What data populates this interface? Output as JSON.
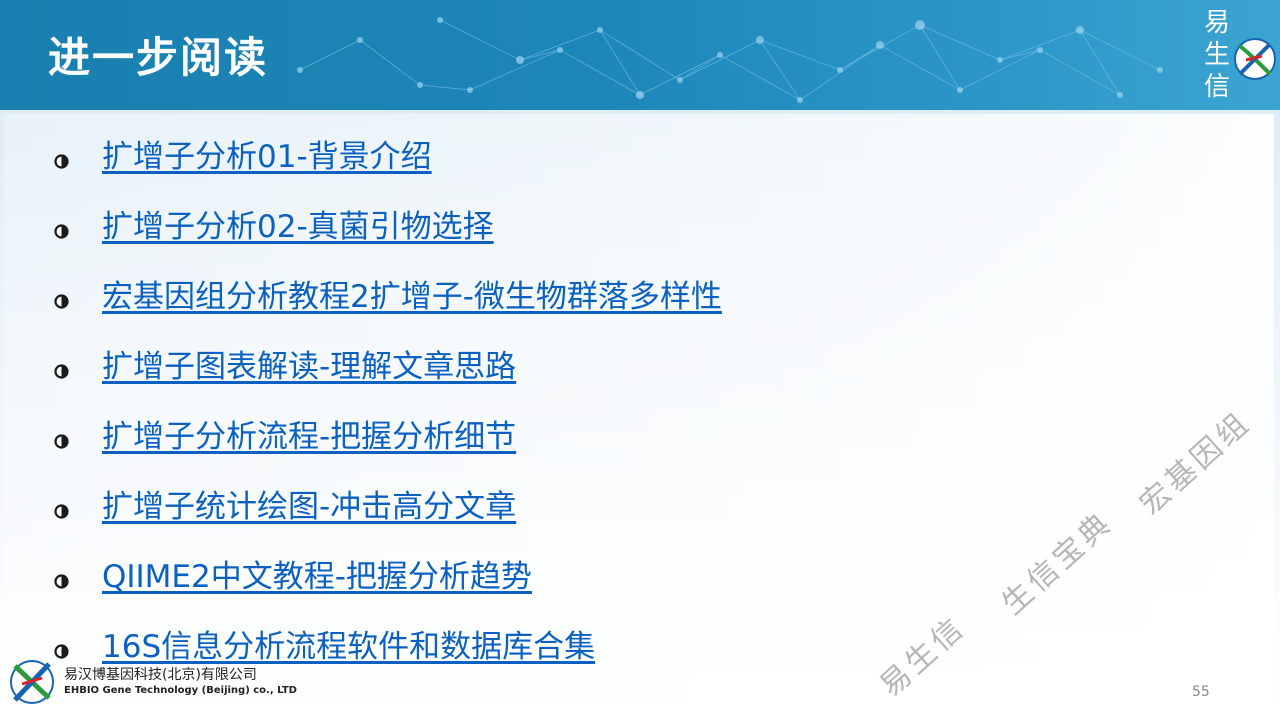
{
  "slide": {
    "title": "进一步阅读",
    "page_number": "55"
  },
  "brand": {
    "chars": [
      "易",
      "生",
      "信"
    ]
  },
  "reading_links": [
    {
      "label": "扩增子分析01-背景介绍"
    },
    {
      "label": "扩增子分析02-真菌引物选择"
    },
    {
      "label": "宏基因组分析教程2扩增子-微生物群落多样性"
    },
    {
      "label": "扩增子图表解读-理解文章思路"
    },
    {
      "label": "扩增子分析流程-把握分析细节"
    },
    {
      "label": "扩增子统计绘图-冲击高分文章"
    },
    {
      "label": "QIIME2中文教程-把握分析趋势"
    },
    {
      "label": "16S信息分析流程软件和数据库合集"
    }
  ],
  "footer": {
    "company_cn": "易汉博基因科技(北京)有限公司",
    "company_en": "EHBIO Gene Technology (Beijing) co., LTD"
  },
  "watermark": {
    "text_1": "易生信",
    "text_2": "生信宝典",
    "text_3": "宏基因组"
  },
  "colors": {
    "header_blue": "#1a7fb0",
    "link_blue": "#0c61c0",
    "logo_green": "#2a9a3a",
    "logo_blue": "#1a63b0",
    "logo_red": "#d8252b"
  }
}
